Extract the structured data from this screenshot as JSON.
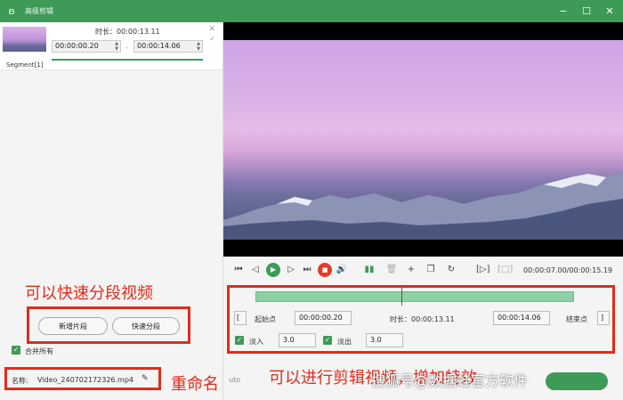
{
  "window": {
    "title": "高级剪辑",
    "minimize": "−",
    "maximize": "☐",
    "close": "✕"
  },
  "segment": {
    "label": "Segment[1]",
    "duration_label": "时长：00:00:13.11",
    "start": "00:00:00.20",
    "end": "00:00:14.06",
    "separator": "-"
  },
  "annotations": {
    "quick_split": "可以快速分段视频",
    "rename": "重命名",
    "clip": "可以进行剪辑视频，增加特效"
  },
  "buttons": {
    "new_segment": "新增片段",
    "quick_split": "快速分段"
  },
  "merge_all": "合并所有",
  "file": {
    "name_label": "名称:",
    "name": "Video_240702172326.mp4"
  },
  "player": {
    "time": "00:00:07.00/00:00:15.19"
  },
  "edit": {
    "start_point": "起始点",
    "start_time": "00:00:00.20",
    "duration": "时长：00:00:13.11",
    "end_time": "00:00:14.06",
    "end_point": "结束点",
    "fade_in_label": "淡入",
    "fade_in": "3.0",
    "fade_out_label": "淡出",
    "fade_out": "3.0"
  },
  "bottom": {
    "partial_label": "uto"
  },
  "watermark": "搜狐号@数据蛙官方软件",
  "colors": {
    "accent": "#3d9a57",
    "annotation": "#e32b1a",
    "record": "#e33a2a"
  }
}
